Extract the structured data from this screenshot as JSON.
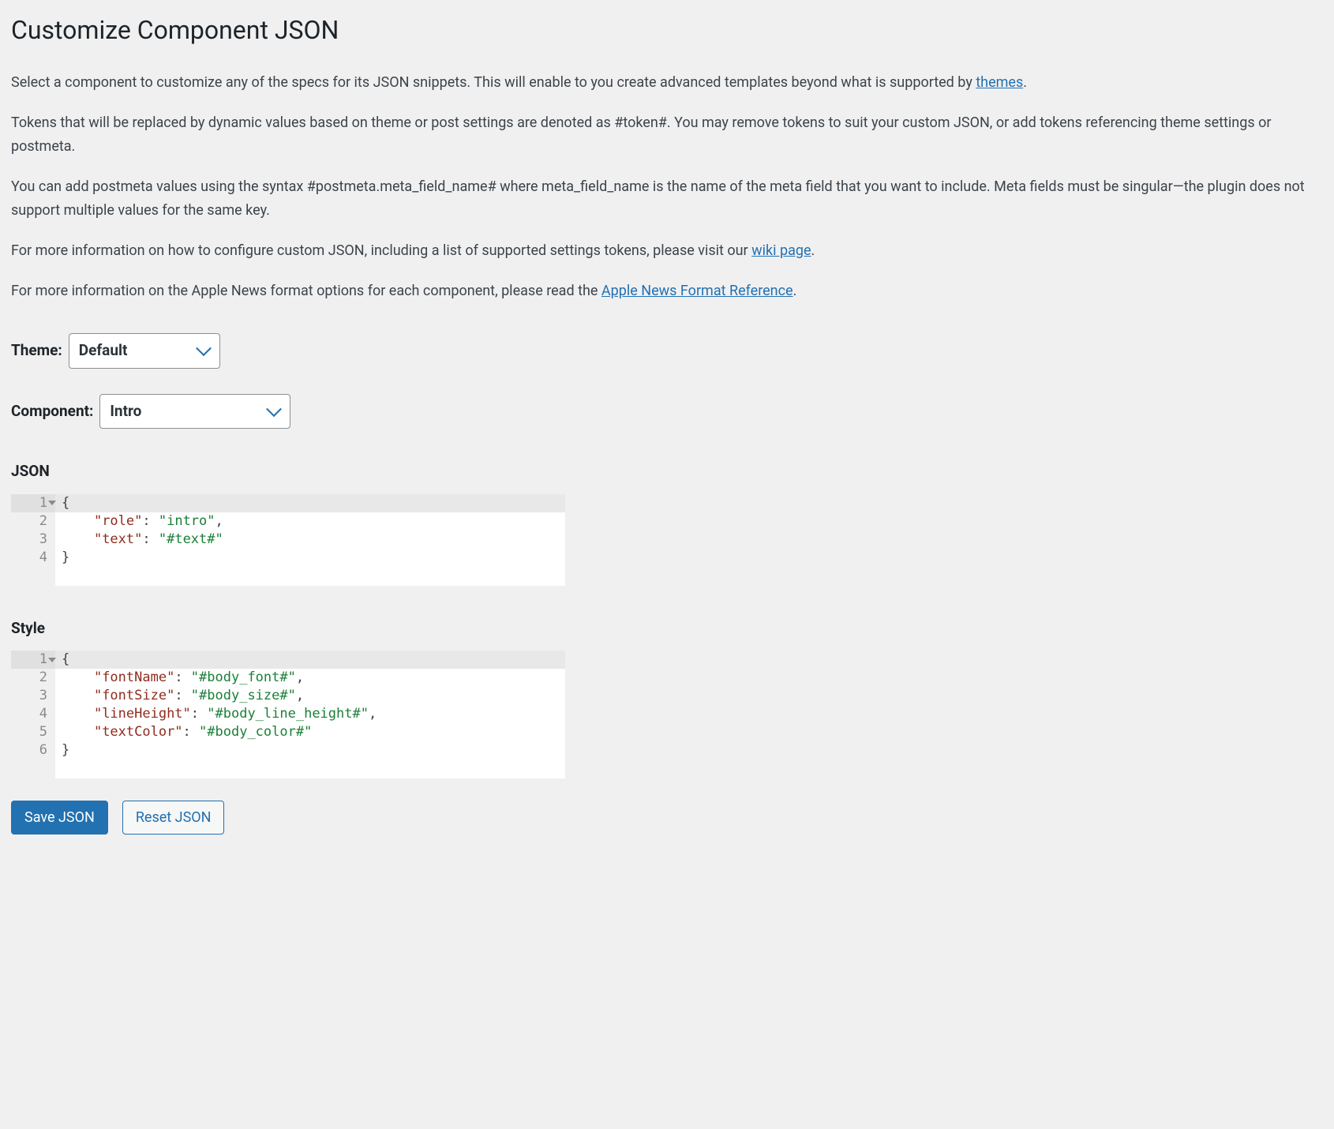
{
  "header": {
    "title": "Customize Component JSON"
  },
  "intro": {
    "p1_pre": "Select a component to customize any of the specs for its JSON snippets. This will enable to you create advanced templates beyond what is supported by ",
    "p1_link": "themes",
    "p1_post": ".",
    "p2": "Tokens that will be replaced by dynamic values based on theme or post settings are denoted as #token#. You may remove tokens to suit your custom JSON, or add tokens referencing theme settings or postmeta.",
    "p3": "You can add postmeta values using the syntax #postmeta.meta_field_name# where meta_field_name is the name of the meta field that you want to include. Meta fields must be singular—the plugin does not support multiple values for the same key.",
    "p4_pre": "For more information on how to configure custom JSON, including a list of supported settings tokens, please visit our ",
    "p4_link": "wiki page",
    "p4_post": ".",
    "p5_pre": "For more information on the Apple News format options for each component, please read the ",
    "p5_link": "Apple News Format Reference",
    "p5_post": "."
  },
  "form": {
    "theme_label": "Theme:",
    "theme_value": "Default",
    "component_label": "Component:",
    "component_value": "Intro"
  },
  "editor1": {
    "label": "JSON",
    "ln1": "1",
    "ln2": "2",
    "ln3": "3",
    "ln4": "4",
    "code": {
      "l1": "{",
      "l2_indent": "    ",
      "l2_k": "\"role\"",
      "l2_sep": ": ",
      "l2_v": "\"intro\"",
      "l2_t": ",",
      "l3_indent": "    ",
      "l3_k": "\"text\"",
      "l3_sep": ": ",
      "l3_v": "\"#text#\"",
      "l4": "}"
    }
  },
  "editor2": {
    "label": "Style",
    "ln1": "1",
    "ln2": "2",
    "ln3": "3",
    "ln4": "4",
    "ln5": "5",
    "ln6": "6",
    "code": {
      "l1": "{",
      "l2_indent": "    ",
      "l2_k": "\"fontName\"",
      "l2_sep": ": ",
      "l2_v": "\"#body_font#\"",
      "l2_t": ",",
      "l3_indent": "    ",
      "l3_k": "\"fontSize\"",
      "l3_sep": ": ",
      "l3_v": "\"#body_size#\"",
      "l3_t": ",",
      "l4_indent": "    ",
      "l4_k": "\"lineHeight\"",
      "l4_sep": ": ",
      "l4_v": "\"#body_line_height#\"",
      "l4_t": ",",
      "l5_indent": "    ",
      "l5_k": "\"textColor\"",
      "l5_sep": ": ",
      "l5_v": "\"#body_color#\"",
      "l6": "}"
    }
  },
  "buttons": {
    "save": "Save JSON",
    "reset": "Reset JSON"
  }
}
